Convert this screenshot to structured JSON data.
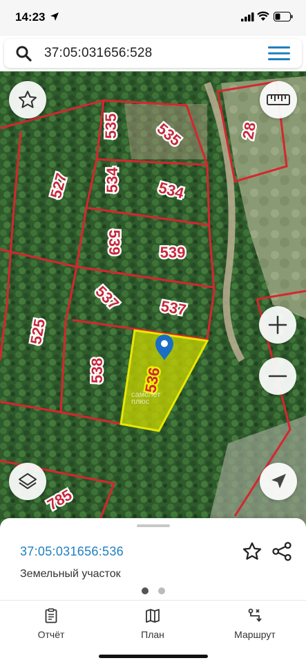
{
  "status_bar": {
    "time": "14:23"
  },
  "search": {
    "query": "37:05:031656:528"
  },
  "map": {
    "plot_labels": [
      "535",
      "535",
      "28",
      "527",
      "534",
      "534",
      "539",
      "539",
      "537",
      "537",
      "525",
      "538",
      "536",
      "785"
    ],
    "watermark_line1": "самолет",
    "watermark_line2": "плюс",
    "colors": {
      "boundary": "#d6262e",
      "selected_fill": "#c8d400",
      "selected_border": "#e8e800",
      "pin": "#1a6fc4"
    }
  },
  "sheet": {
    "cadastral_number": "37:05:031656:536",
    "type": "Земельный участок",
    "page_count": 2,
    "active_page": 1
  },
  "tabs": [
    {
      "label": "Отчёт",
      "icon": "report-icon"
    },
    {
      "label": "План",
      "icon": "map-icon"
    },
    {
      "label": "Маршрут",
      "icon": "route-icon"
    }
  ]
}
